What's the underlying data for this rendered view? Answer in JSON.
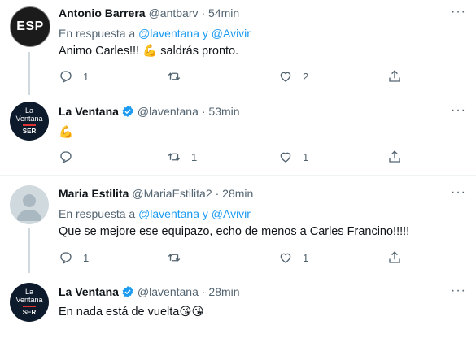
{
  "tweets": [
    {
      "name": "Antonio Barrera",
      "handle": "@antbarv",
      "time": "· 54min",
      "avatar_text": "ESP",
      "reply_prefix": "En respuesta a",
      "reply_targets": "@laventana y @Avivir",
      "text": "Animo Carles!!! 💪 saldrás pronto.",
      "replies": "1",
      "retweets": "",
      "likes": "2"
    },
    {
      "name": "La Ventana",
      "handle": "@laventana",
      "time": "· 53min",
      "avatar_text": [
        "La",
        "Ventana",
        "SER"
      ],
      "text": "💪",
      "replies": "",
      "retweets": "1",
      "likes": "1"
    },
    {
      "name": "Maria Estilita",
      "handle": "@MariaEstilita2",
      "time": "· 28min",
      "reply_prefix": "En respuesta a",
      "reply_targets": "@laventana y @Avivir",
      "text": "Que se mejore ese equipazo, echo de menos a Carles Francino!!!!!",
      "replies": "1",
      "retweets": "",
      "likes": "1"
    },
    {
      "name": "La Ventana",
      "handle": "@laventana",
      "time": "· 28min",
      "avatar_text": [
        "La",
        "Ventana",
        "SER"
      ],
      "text": "En nada está de vuelta😘😘"
    }
  ],
  "icons": {
    "reply": "reply-icon",
    "retweet": "retweet-icon",
    "like": "heart-icon",
    "share": "share-icon",
    "verified": "verified-badge-icon",
    "more": "more-icon"
  },
  "colors": {
    "link": "#1d9bf0",
    "muted": "#536471",
    "text": "#0f1419",
    "verified": "#1d9bf0"
  }
}
